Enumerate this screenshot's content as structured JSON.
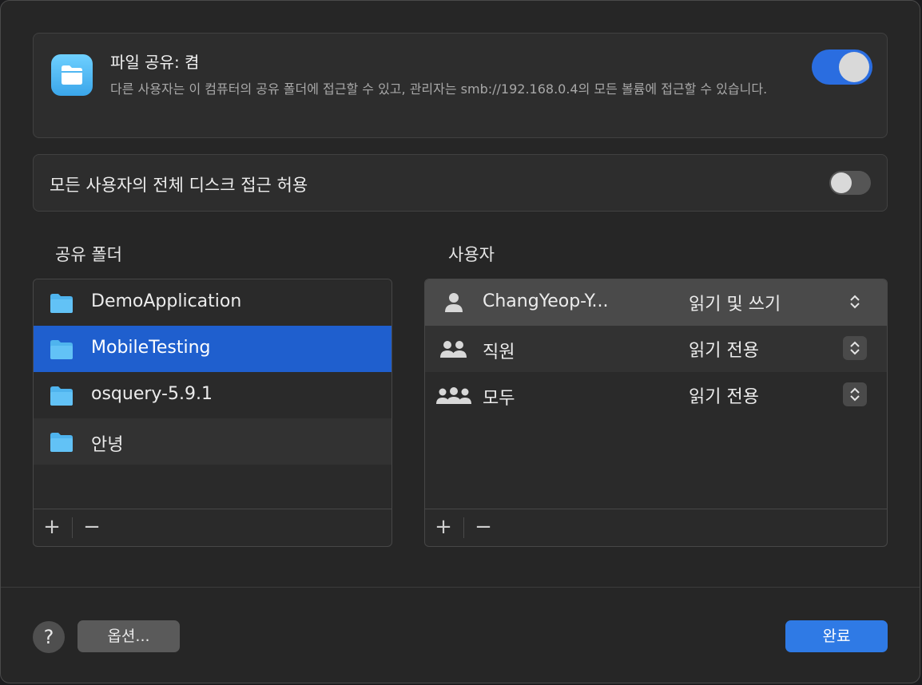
{
  "file_sharing": {
    "title": "파일 공유: 켬",
    "description": "다른 사용자는 이 컴퓨터의 공유 폴더에 접근할 수 있고, 관리자는 smb://192.168.0.4의 모든 볼륨에 접근할 수 있습니다.",
    "enabled": true,
    "icon": "folder-icon"
  },
  "full_disk": {
    "label": "모든 사용자의 전체 디스크 접근 허용",
    "enabled": false
  },
  "shared_folders": {
    "title": "공유 폴더",
    "items": [
      {
        "name": "DemoApplication",
        "selected": false
      },
      {
        "name": "MobileTesting",
        "selected": true
      },
      {
        "name": "osquery-5.9.1",
        "selected": false
      },
      {
        "name": "안녕",
        "selected": false
      }
    ],
    "add_label": "+",
    "remove_label": "−"
  },
  "users": {
    "title": "사용자",
    "items": [
      {
        "name": "ChangYeop-Y...",
        "permission": "읽기 및 쓰기",
        "icon": "person-icon"
      },
      {
        "name": "직원",
        "permission": "읽기 전용",
        "icon": "two-people-icon"
      },
      {
        "name": "모두",
        "permission": "읽기 전용",
        "icon": "group-icon"
      }
    ],
    "add_label": "+",
    "remove_label": "−"
  },
  "footer": {
    "help_label": "?",
    "options_label": "옵션...",
    "done_label": "완료"
  },
  "colors": {
    "accent": "#2a6de0",
    "selection": "#1f5fce"
  }
}
